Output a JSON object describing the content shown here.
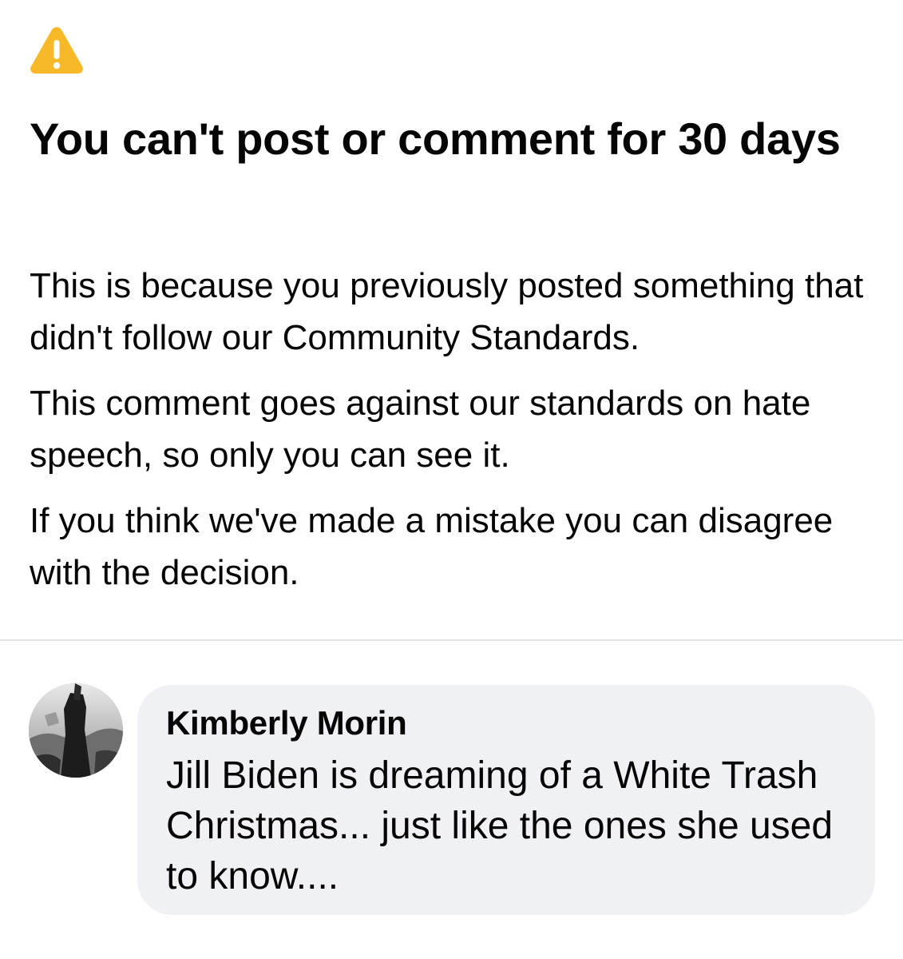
{
  "notice": {
    "icon": "warning-triangle-icon",
    "icon_color": "#f7b928",
    "headline": "You can't post or comment for 30 days",
    "paragraphs": [
      "This is because you previously posted something that didn't follow our Community Standards.",
      "This comment goes against our standards on hate speech, so only you can see it.",
      "If you think we've made a mistake you can disagree with the decision."
    ]
  },
  "comment": {
    "avatar": "profile-avatar",
    "author": "Kimberly Morin",
    "text": "Jill Biden is dreaming of a White Trash Christmas... just like the ones she used to know....",
    "bubble_color": "#f0f1f5"
  }
}
